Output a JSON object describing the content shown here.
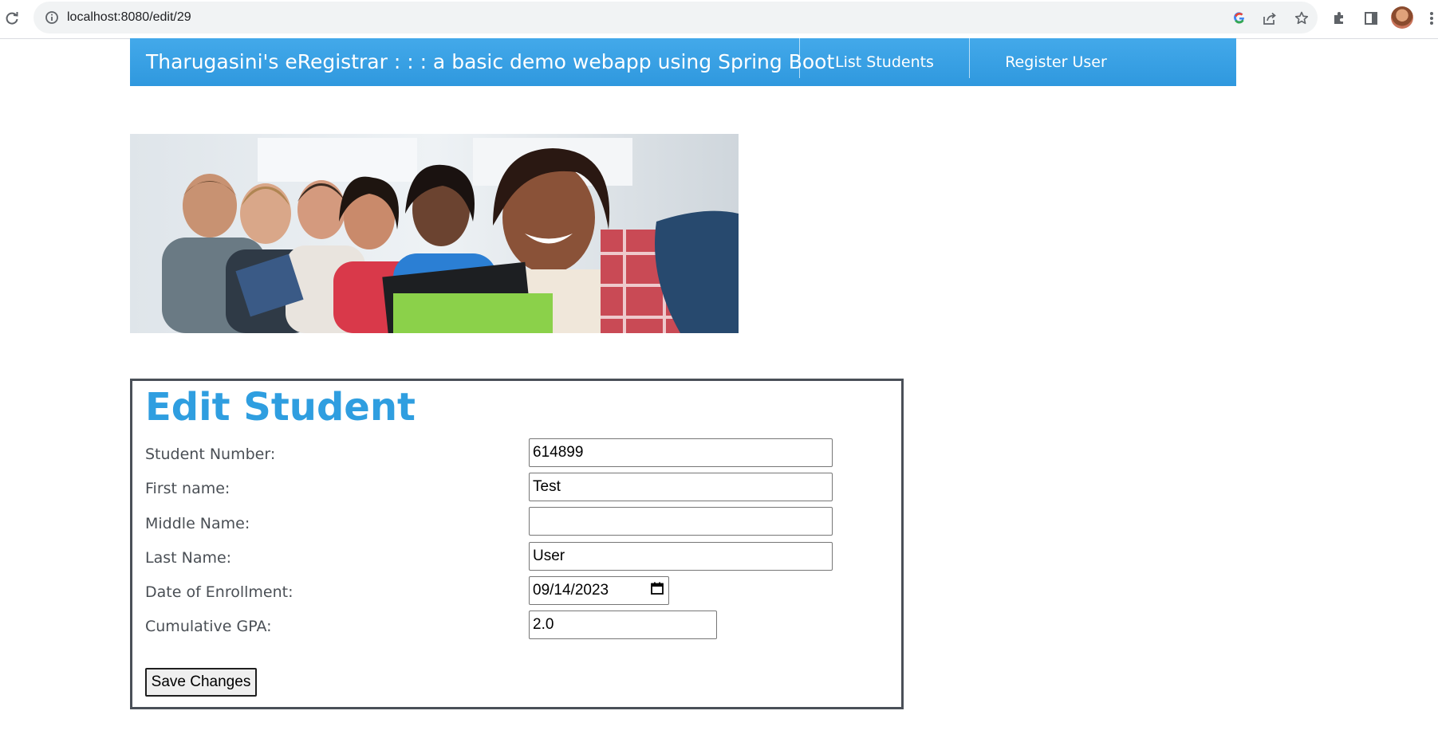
{
  "browser": {
    "url": "localhost:8080/edit/29"
  },
  "header": {
    "brand": "Tharugasini's eRegistrar : : : a basic demo webapp using Spring Boot",
    "nav": [
      {
        "label": "List Students"
      },
      {
        "label": "Register User"
      }
    ],
    "color": "#3aa3e6"
  },
  "banner": {
    "icon": "students-photo"
  },
  "form": {
    "title": "Edit Student",
    "fields": {
      "student_number": {
        "label": "Student Number:",
        "value": "614899"
      },
      "first_name": {
        "label": "First name:",
        "value": "Test"
      },
      "middle_name": {
        "label": "Middle Name:",
        "value": ""
      },
      "last_name": {
        "label": "Last Name:",
        "value": "User"
      },
      "enrollment_date": {
        "label": "Date of Enrollment:",
        "value": "09/14/2023"
      },
      "gpa": {
        "label": "Cumulative GPA:",
        "value": "2.0"
      }
    },
    "save_label": "Save Changes",
    "title_color": "#2f9ee0"
  }
}
